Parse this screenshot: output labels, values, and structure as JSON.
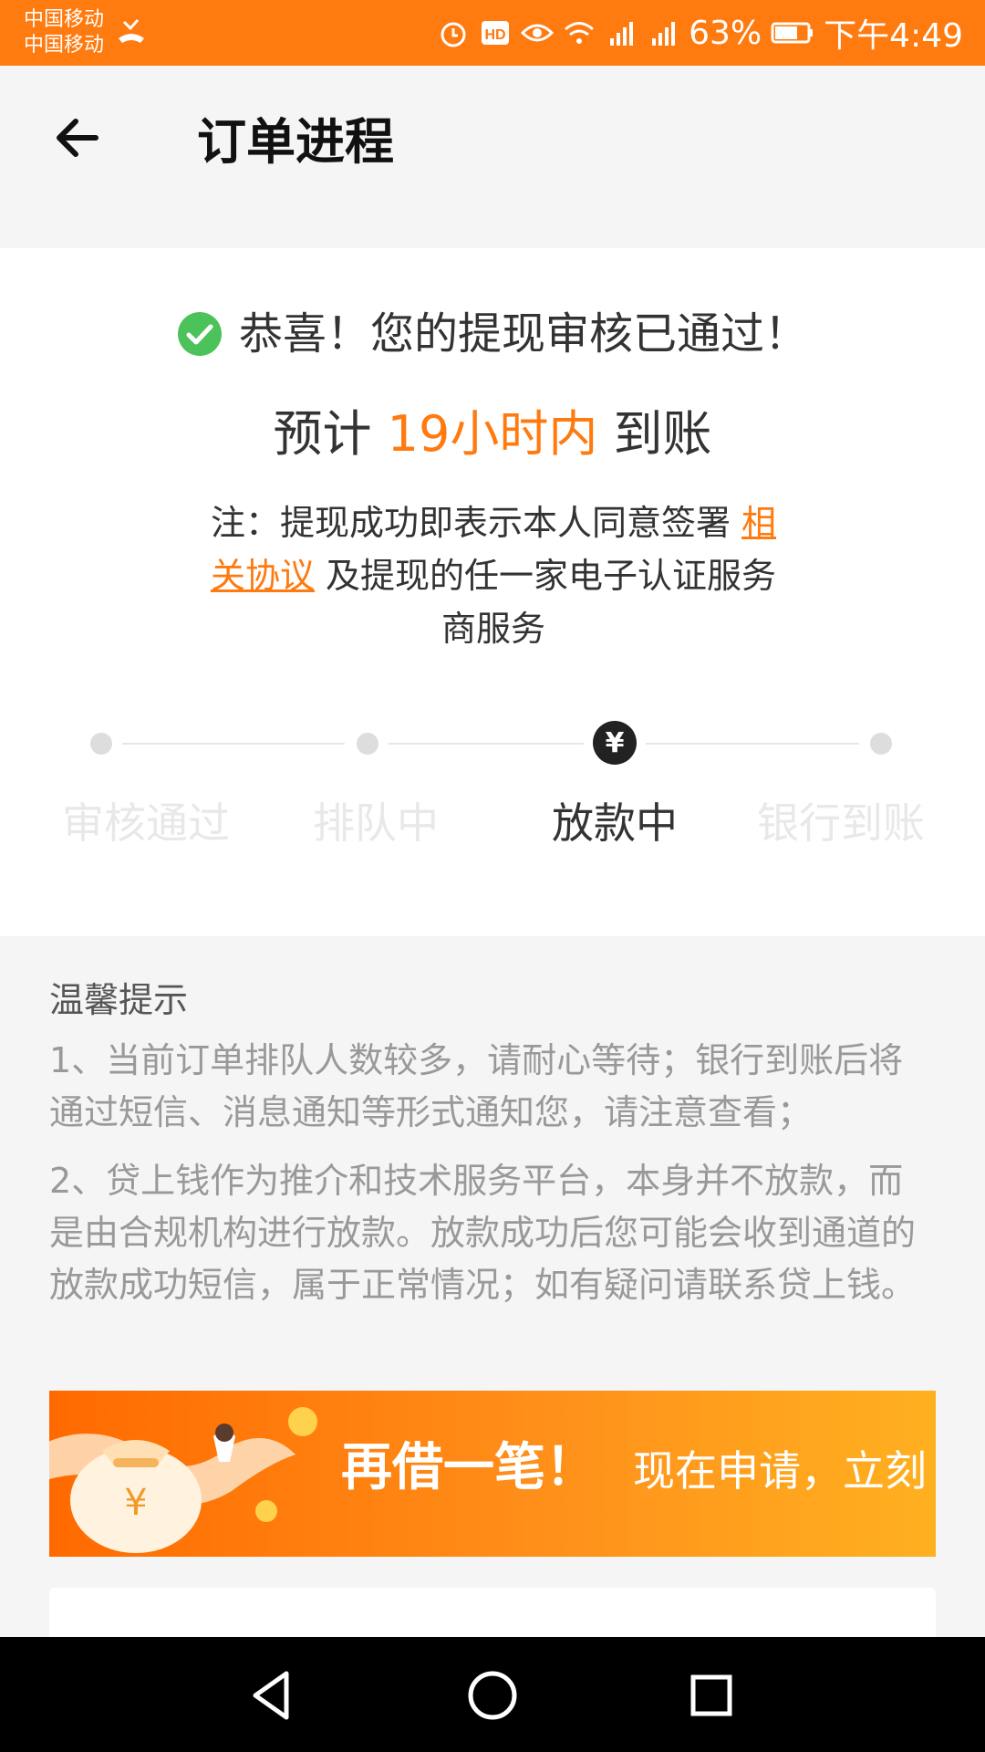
{
  "status_bar": {
    "carrier1": "中国移动",
    "carrier2": "中国移动",
    "battery": "63%",
    "time": "下午4:49",
    "icons": [
      "missed-call-icon",
      "alarm-icon",
      "hd-icon",
      "eye-icon",
      "wifi-icon",
      "signal-4g-icon",
      "signal-2g-icon",
      "battery-icon"
    ],
    "background": "#ff7a0f"
  },
  "header": {
    "title": "订单进程",
    "back_icon": "arrow-left-icon"
  },
  "status": {
    "success": "恭喜！您的提现审核已通过！",
    "eta_prefix": "预计",
    "eta_highlight": "19小时内",
    "eta_suffix": "到账",
    "note_prefix": "注：提现成功即表示本人同意签署",
    "note_link": "相关协议",
    "note_suffix": "及提现的任一家电子认证服务商服务",
    "accent": "#ff7a0f"
  },
  "steps": [
    {
      "label": "审核通过",
      "state": "done"
    },
    {
      "label": "排队中",
      "state": "done"
    },
    {
      "label": "放款中",
      "state": "current",
      "icon_text": "¥"
    },
    {
      "label": "银行到账",
      "state": "pending"
    }
  ],
  "tips": {
    "title": "温馨提示",
    "items": [
      "1、当前订单排队人数较多，请耐心等待；银行到账后将通过短信、消息通知等形式通知您，请注意查看；",
      "2、贷上钱作为推介和技术服务平台，本身并不放款，而是由合规机构进行放款。放款成功后您可能会收到通道的放款成功短信，属于正常情况；如有疑问请联系贷上钱。"
    ]
  },
  "banner": {
    "title": "再借一笔！",
    "subtitle": "现在申请，立刻"
  }
}
